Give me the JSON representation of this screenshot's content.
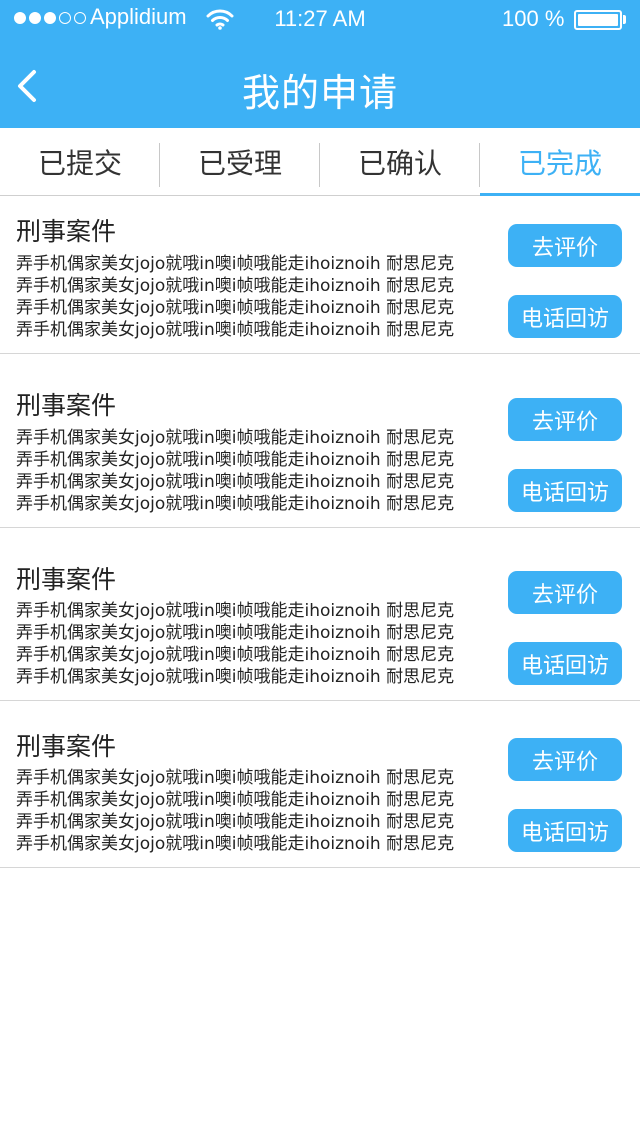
{
  "status_bar": {
    "carrier": "Applidium",
    "time": "11:27 AM",
    "battery": "100 %",
    "signal_bars": 3
  },
  "header": {
    "title": "我的申请"
  },
  "tabs": [
    {
      "label": "已提交",
      "active": false
    },
    {
      "label": "已受理",
      "active": false
    },
    {
      "label": "已确认",
      "active": false
    },
    {
      "label": "已完成",
      "active": true
    }
  ],
  "items": [
    {
      "title": "刑事案件",
      "lines": [
        "弄手机偶家美女jojo就哦in噢i帧哦能走ihoiznoih 耐思尼克",
        "弄手机偶家美女jojo就哦in噢i帧哦能走ihoiznoih 耐思尼克",
        "弄手机偶家美女jojo就哦in噢i帧哦能走ihoiznoih 耐思尼克",
        "弄手机偶家美女jojo就哦in噢i帧哦能走ihoiznoih 耐思尼克"
      ],
      "evaluate_label": "去评价",
      "callback_label": "电话回访"
    },
    {
      "title": "刑事案件",
      "lines": [
        "弄手机偶家美女jojo就哦in噢i帧哦能走ihoiznoih 耐思尼克",
        "弄手机偶家美女jojo就哦in噢i帧哦能走ihoiznoih 耐思尼克",
        "弄手机偶家美女jojo就哦in噢i帧哦能走ihoiznoih 耐思尼克",
        "弄手机偶家美女jojo就哦in噢i帧哦能走ihoiznoih 耐思尼克"
      ],
      "evaluate_label": "去评价",
      "callback_label": "电话回访"
    },
    {
      "title": "刑事案件",
      "lines": [
        "弄手机偶家美女jojo就哦in噢i帧哦能走ihoiznoih 耐思尼克",
        "弄手机偶家美女jojo就哦in噢i帧哦能走ihoiznoih 耐思尼克",
        "弄手机偶家美女jojo就哦in噢i帧哦能走ihoiznoih 耐思尼克",
        "弄手机偶家美女jojo就哦in噢i帧哦能走ihoiznoih 耐思尼克"
      ],
      "evaluate_label": "去评价",
      "callback_label": "电话回访"
    },
    {
      "title": "刑事案件",
      "lines": [
        "弄手机偶家美女jojo就哦in噢i帧哦能走ihoiznoih 耐思尼克",
        "弄手机偶家美女jojo就哦in噢i帧哦能走ihoiznoih 耐思尼克",
        "弄手机偶家美女jojo就哦in噢i帧哦能走ihoiznoih 耐思尼克",
        "弄手机偶家美女jojo就哦in噢i帧哦能走ihoiznoih 耐思尼克"
      ],
      "evaluate_label": "去评价",
      "callback_label": "电话回访"
    }
  ],
  "colors": {
    "accent": "#3db1f5",
    "text": "#222222",
    "divider": "#d6d6d6"
  },
  "icons": {
    "back": "chevron-left-icon",
    "wifi": "wifi-icon",
    "battery": "battery-icon"
  }
}
